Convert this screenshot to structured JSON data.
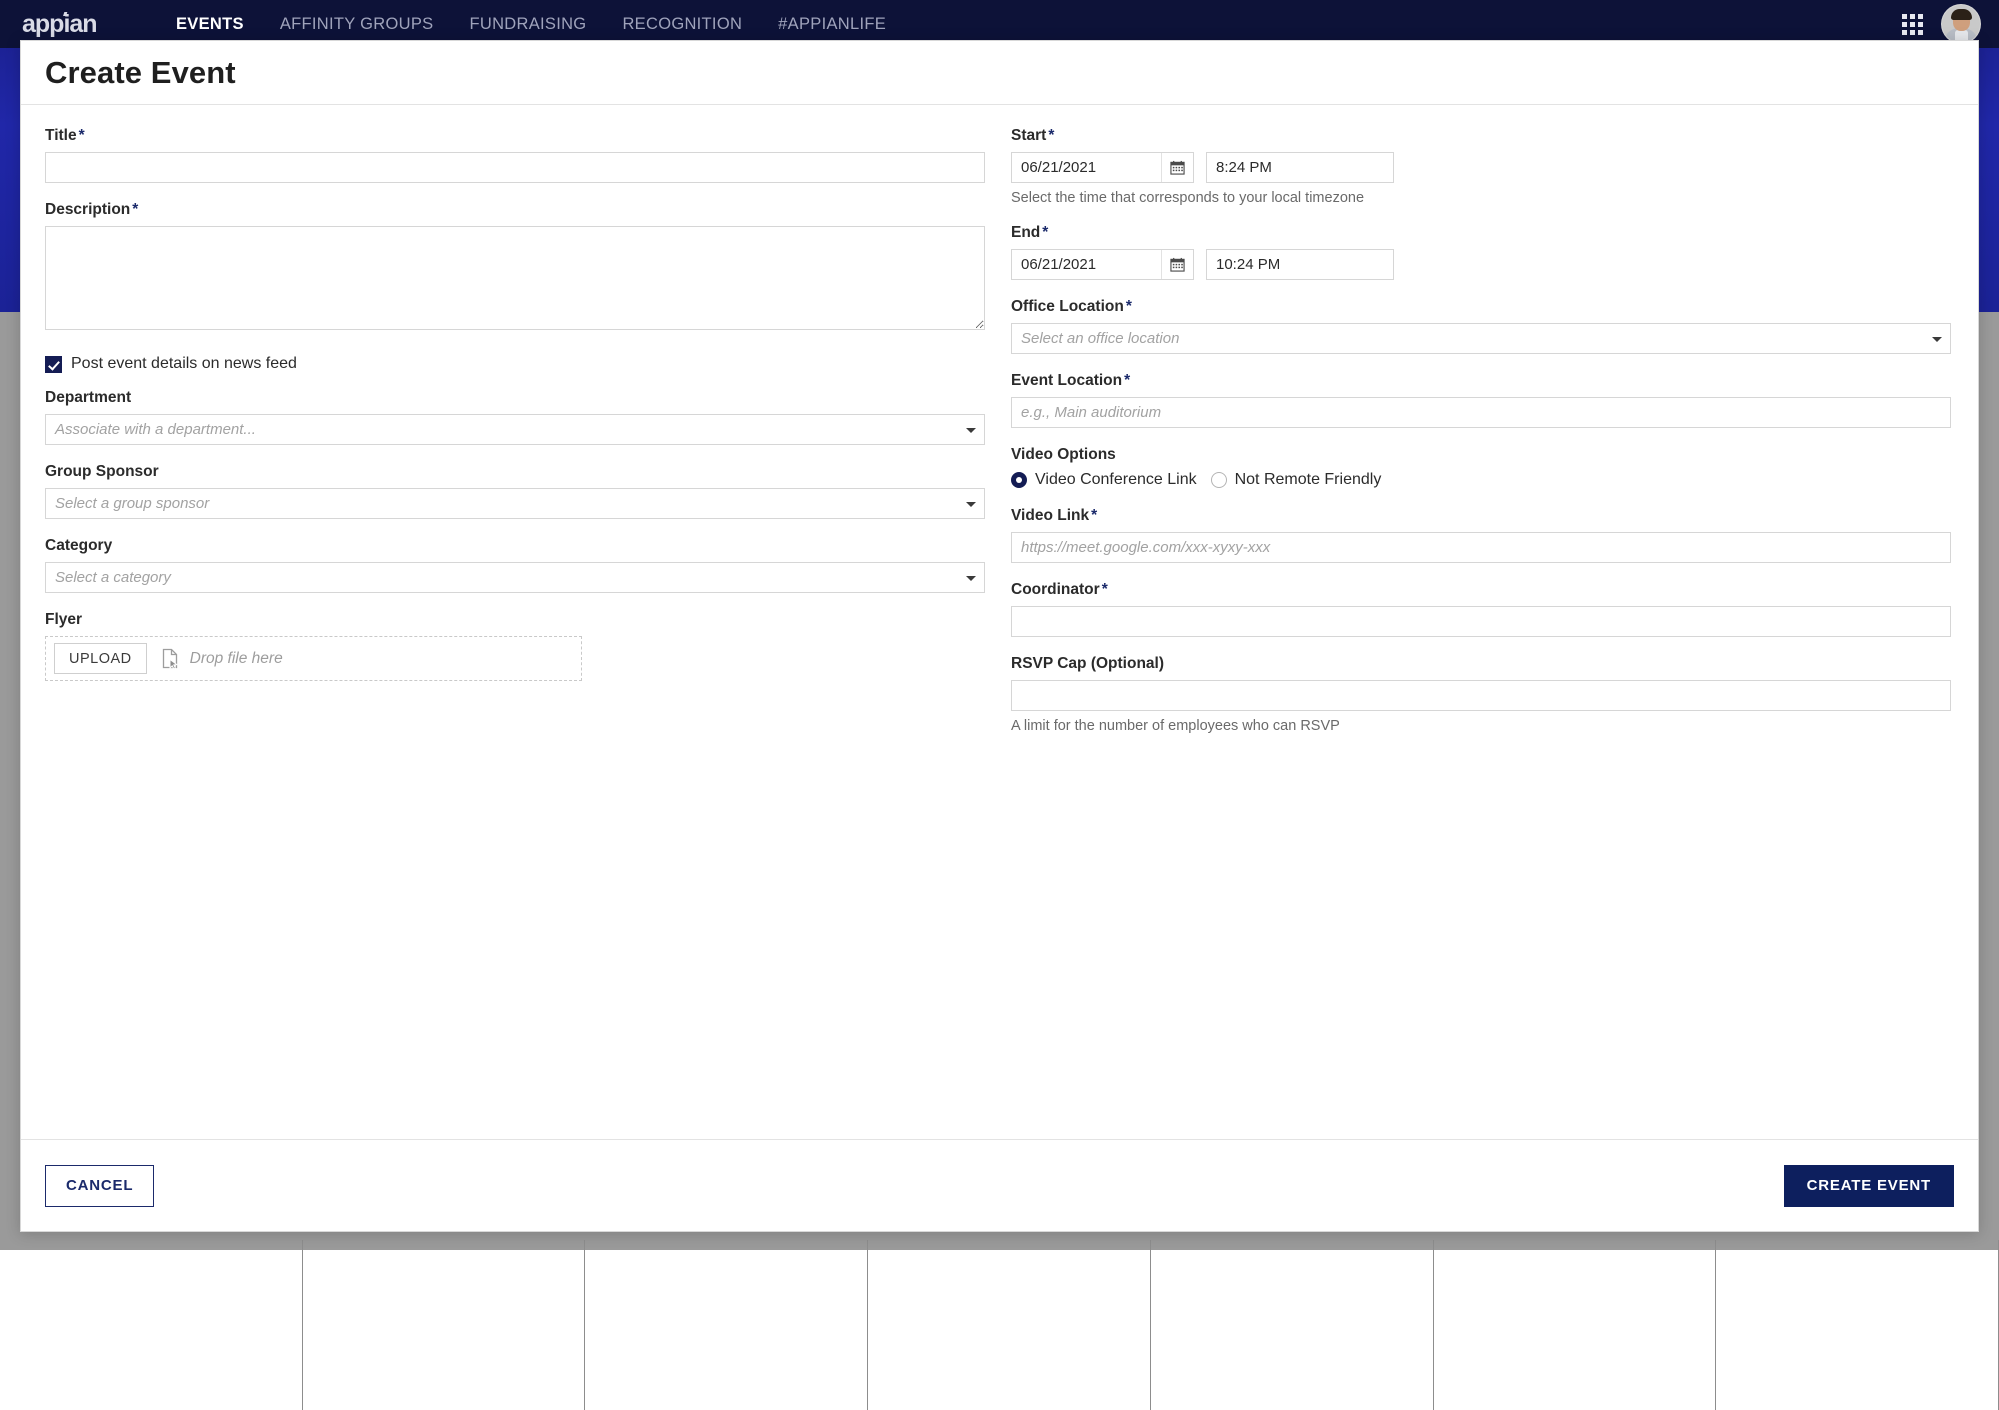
{
  "nav": {
    "brand": "appian",
    "links": [
      {
        "label": "EVENTS",
        "active": true
      },
      {
        "label": "AFFINITY GROUPS",
        "active": false
      },
      {
        "label": "FUNDRAISING",
        "active": false
      },
      {
        "label": "RECOGNITION",
        "active": false
      },
      {
        "label": "#APPIANLIFE",
        "active": false
      }
    ],
    "apps_icon": "grid-apps-icon",
    "avatar": "user-avatar"
  },
  "modal": {
    "title": "Create Event",
    "left": {
      "title": {
        "label": "Title",
        "required": "*",
        "value": "",
        "placeholder": ""
      },
      "description": {
        "label": "Description",
        "required": "*",
        "value": "",
        "placeholder": ""
      },
      "post_news_feed": {
        "label": "Post event details on news feed",
        "checked": true
      },
      "department": {
        "label": "Department",
        "placeholder": "Associate with a department..."
      },
      "group_sponsor": {
        "label": "Group Sponsor",
        "placeholder": "Select a group sponsor"
      },
      "category": {
        "label": "Category",
        "placeholder": "Select a category"
      },
      "flyer": {
        "label": "Flyer",
        "upload_button": "UPLOAD",
        "drop_text": "Drop file here"
      }
    },
    "right": {
      "start": {
        "label": "Start",
        "required": "*",
        "date": "06/21/2021",
        "time": "8:24 PM",
        "hint": "Select the time that corresponds to your local timezone"
      },
      "end": {
        "label": "End",
        "required": "*",
        "date": "06/21/2021",
        "time": "10:24 PM"
      },
      "office_location": {
        "label": "Office Location",
        "required": "*",
        "placeholder": "Select an office location"
      },
      "event_location": {
        "label": "Event Location",
        "required": "*",
        "placeholder": "e.g., Main auditorium",
        "value": ""
      },
      "video_options": {
        "label": "Video Options",
        "options": [
          {
            "label": "Video Conference Link",
            "selected": true
          },
          {
            "label": "Not Remote Friendly",
            "selected": false
          }
        ]
      },
      "video_link": {
        "label": "Video Link",
        "required": "*",
        "placeholder": "https://meet.google.com/xxx-xyxy-xxx",
        "value": ""
      },
      "coordinator": {
        "label": "Coordinator",
        "required": "*",
        "value": "",
        "placeholder": ""
      },
      "rsvp_cap": {
        "label": "RSVP Cap (Optional)",
        "value": "",
        "placeholder": "",
        "hint": "A limit for the number of employees who can RSVP"
      }
    },
    "footer": {
      "cancel": "CANCEL",
      "submit": "CREATE EVENT"
    }
  },
  "colors": {
    "navbar": "#0d1238",
    "accent": "#0d1f5e",
    "required_asterisk": "#1b2a6b",
    "checkbox_fill": "#141c54",
    "hero_blue": "#1f27a0",
    "dim_overlay": "#9a9a9a"
  }
}
